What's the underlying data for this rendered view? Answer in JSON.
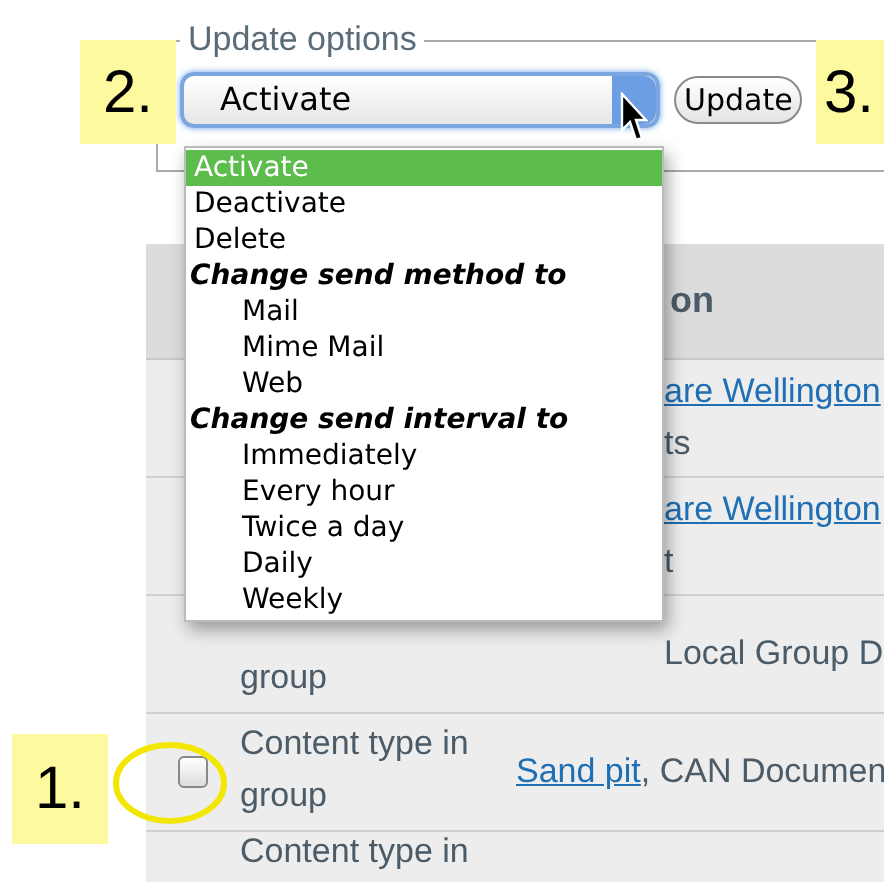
{
  "fieldset": {
    "legend": "Update options"
  },
  "select": {
    "value": "Activate",
    "expanded": true
  },
  "update_button": {
    "label": "Update"
  },
  "dropdown": {
    "items": [
      {
        "kind": "option",
        "label": "Activate",
        "selected": true
      },
      {
        "kind": "option",
        "label": "Deactivate",
        "selected": false
      },
      {
        "kind": "option",
        "label": "Delete",
        "selected": false
      },
      {
        "kind": "group",
        "label": "Change send method to",
        "children": [
          {
            "kind": "option",
            "label": "Mail",
            "selected": false
          },
          {
            "kind": "option",
            "label": "Mime Mail",
            "selected": false
          },
          {
            "kind": "option",
            "label": "Web",
            "selected": false
          }
        ]
      },
      {
        "kind": "group",
        "label": "Change send interval to",
        "children": [
          {
            "kind": "option",
            "label": "Immediately",
            "selected": false
          },
          {
            "kind": "option",
            "label": "Every hour",
            "selected": false
          },
          {
            "kind": "option",
            "label": "Twice a day",
            "selected": false
          },
          {
            "kind": "option",
            "label": "Daily",
            "selected": false
          },
          {
            "kind": "option",
            "label": "Weekly",
            "selected": false
          }
        ]
      }
    ]
  },
  "table": {
    "columns": [
      "on"
    ],
    "rows": [
      {
        "description": [
          {
            "kind": "link",
            "text": "are Wellington"
          },
          {
            "kind": "text",
            "text": "ts"
          }
        ]
      },
      {
        "description": [
          {
            "kind": "link",
            "text": "are Wellington"
          },
          {
            "kind": "text",
            "text": "t"
          }
        ]
      },
      {
        "type": "group",
        "description": [
          {
            "kind": "text",
            "text": "Local Group D"
          }
        ]
      },
      {
        "checked": false,
        "type": "Content type in group",
        "description": [
          {
            "kind": "link",
            "text": "Sand pit"
          },
          {
            "kind": "text",
            "text": ", CAN Documen"
          }
        ]
      },
      {
        "type": "Content type in"
      }
    ]
  },
  "annotations": [
    {
      "label": "2."
    },
    {
      "label": "3."
    },
    {
      "label": "1."
    }
  ]
}
